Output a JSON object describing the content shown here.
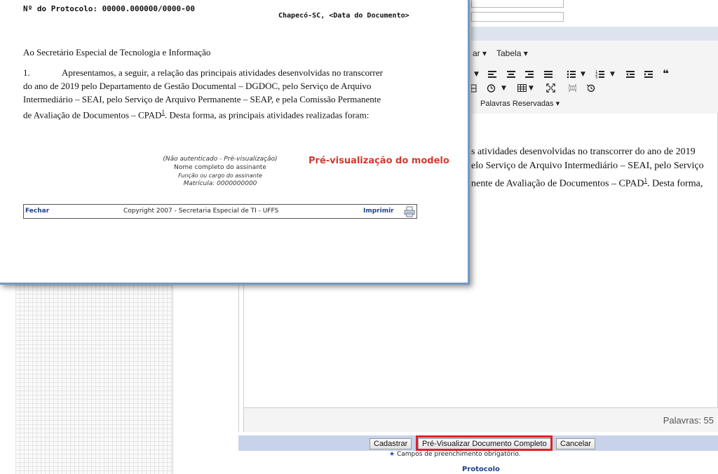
{
  "background": {
    "toolbar": {
      "menu_partial": "ar",
      "table_menu": "Tabela",
      "reserved_words_menu": "Palavras Reservadas"
    },
    "editor": {
      "lines": [
        "s atividades desenvolvidas no transcorrer do ano de 2019",
        "elo Serviço de Arquivo Intermediário – SEAI, pelo Serviço",
        "nente de Avaliação de Documentos – CPAD"
      ],
      "footnote": "1",
      "line3_tail": ". Desta forma,"
    },
    "word_count": "Palavras: 55",
    "buttons": {
      "register": "Cadastrar",
      "preview_full": "Pré-Visualizar Documento Completo",
      "cancel": "Cancelar"
    },
    "required_note": "Campos de preenchimento obrigatório.",
    "required_star": "★",
    "protocol_link": "Protocolo",
    "highlight_color": "#e0202a"
  },
  "popup": {
    "protocol_number": "Nº do Protocolo: 00000.000000/0000-00",
    "place_date": "Chapecó-SC, <Data do Documento>",
    "recipient": "Ao Secretário Especial de Tecnologia e Informação",
    "paragraph_number": "1.",
    "paragraph_lines": [
      "Apresentamos, a seguir, a relação das principais atividades desenvolvidas no transcorrer",
      "do ano de 2019 pelo Departamento de Gestão Documental – DGDOC, pelo Serviço de Arquivo",
      "Intermediário – SEAI, pelo Serviço de Arquivo Permanente – SEAP, e pela Comissão Permanente",
      "de Avaliação de Documentos – CPAD"
    ],
    "footnote": "1",
    "paragraph_tail": ". Desta forma, as principais atividades realizadas foram:",
    "signature": {
      "status": "(Não autenticado - Pré-visualização)",
      "name": "Nome completo do assinante",
      "role": "Função ou cargo do assinante",
      "registration": "Matrícula: 0000000000"
    },
    "preview_label": "Pré-visualização do modelo",
    "preview_label_color": "#d43a2f",
    "footer": {
      "close": "Fechar",
      "copyright": "Copyright 2007 - Secretaria Especial de TI - UFFS",
      "print": "Imprimir"
    }
  }
}
